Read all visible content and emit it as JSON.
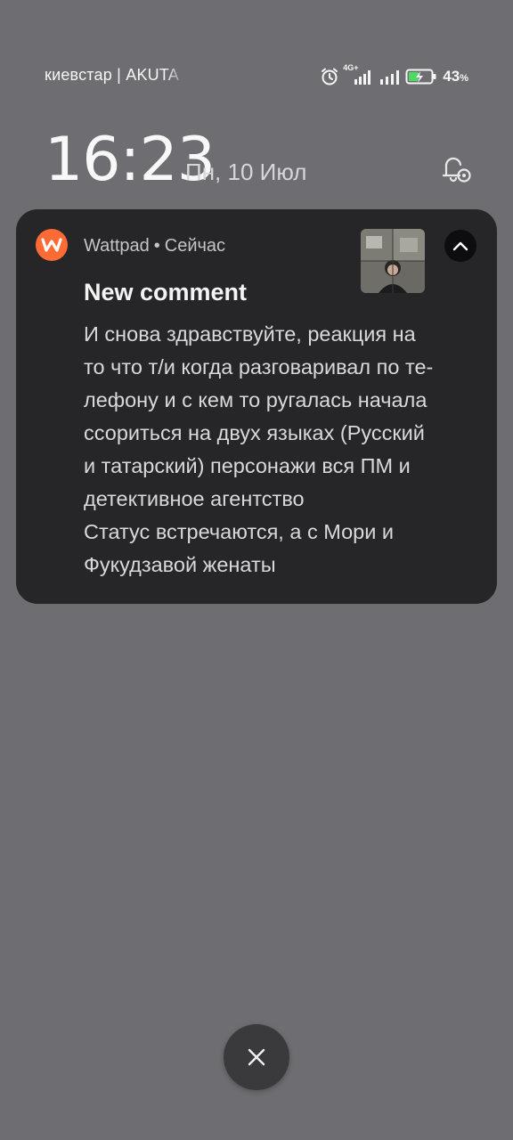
{
  "status_bar": {
    "carrier": "киевстар | AKUTA",
    "network": "4G+",
    "battery_percent": "43",
    "battery_unit": "%",
    "icons": [
      "alarm-icon",
      "signal-icon",
      "signal-icon",
      "battery-charging-icon"
    ]
  },
  "lockscreen": {
    "time": "16:23",
    "date": "Пн, 10 Июл"
  },
  "notification": {
    "app_name": "Wattpad",
    "separator": "•",
    "time": "Сейчас",
    "title": "New comment",
    "body_lines": [
      "И снова здравствуйте, реакция на",
      "то что т/и когда разговаривал по те-",
      "лефону и с кем то ругалась начала",
      "ссориться на двух языках (Русский",
      "и татарский) персонажи вся ПМ и",
      "детективное агентство",
      "Статус встречаются, а с Мори и",
      "Фукудзавой женаты"
    ],
    "accent_color": "#ff6b35",
    "app_icon": "wattpad-logo-icon"
  },
  "colors": {
    "background": "#6e6d71",
    "card": "#262528"
  }
}
